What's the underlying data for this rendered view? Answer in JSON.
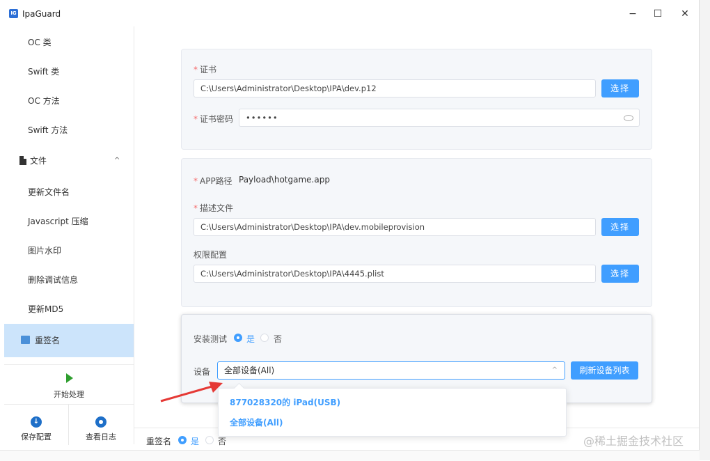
{
  "window": {
    "title": "IpaGuard",
    "icon_text": "IG",
    "minimize": "−",
    "maximize": "☐",
    "close": "✕"
  },
  "sidebar": {
    "items": [
      {
        "label": "OC 类"
      },
      {
        "label": "Swift 类"
      },
      {
        "label": "OC 方法"
      },
      {
        "label": "Swift 方法"
      }
    ],
    "group": {
      "label": "文件",
      "chevron": "^"
    },
    "sub_items": [
      {
        "label": "更新文件名"
      },
      {
        "label": "Javascript 压缩"
      },
      {
        "label": "图片水印"
      },
      {
        "label": "删除调试信息"
      },
      {
        "label": "更新MD5"
      }
    ],
    "active": {
      "label": "重签名"
    },
    "start": {
      "label": "开始处理"
    },
    "save": {
      "label": "保存配置"
    },
    "log": {
      "label": "查看日志"
    }
  },
  "cert": {
    "label": "证书",
    "value": "C:\\Users\\Administrator\\Desktop\\IPA\\dev.p12",
    "button": "选择",
    "password_label": "证书密码",
    "password_value": "••••••"
  },
  "app": {
    "path_label": "APP路径",
    "path_value": "Payload\\hotgame.app",
    "profile_label": "描述文件",
    "profile_value": "C:\\Users\\Administrator\\Desktop\\IPA\\dev.mobileprovision",
    "profile_button": "选择",
    "entitlements_label": "权限配置",
    "entitlements_value": "C:\\Users\\Administrator\\Desktop\\IPA\\4445.plist",
    "entitlements_button": "选择"
  },
  "install": {
    "label": "安装测试",
    "yes": "是",
    "no": "否",
    "device_label": "设备",
    "device_value": "全部设备(All)",
    "refresh_button": "刷新设备列表",
    "options": [
      "877028320的 iPad(USB)",
      "全部设备(All)"
    ]
  },
  "footer": {
    "label": "重签名",
    "yes": "是",
    "no": "否"
  },
  "watermark": "@稀土掘金技术社区",
  "colors": {
    "accent": "#409eff",
    "active_bg": "#cce4fb",
    "required": "#f56c6c",
    "arrow": "#e53935"
  }
}
